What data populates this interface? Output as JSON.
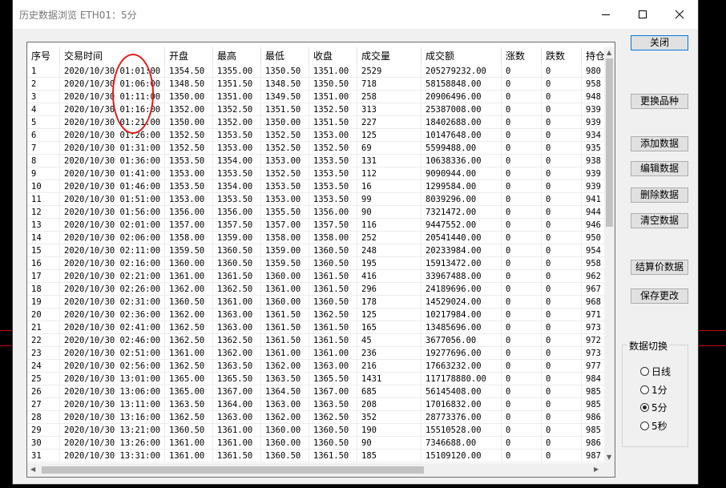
{
  "window": {
    "title": "历史数据浏览 ETH01：5分"
  },
  "table": {
    "columns": [
      "序号",
      "交易时间",
      "开盘",
      "最高",
      "最低",
      "收盘",
      "成交量",
      "成交额",
      "涨数",
      "跌数",
      "持仓"
    ],
    "rows": [
      [
        "1",
        "2020/10/30 01:01:00",
        "1354.50",
        "1355.00",
        "1350.50",
        "1351.00",
        "2529",
        "205279232.00",
        "0",
        "0",
        "980"
      ],
      [
        "2",
        "2020/10/30 01:06:00",
        "1348.50",
        "1351.50",
        "1348.50",
        "1350.50",
        "718",
        "58158848.00",
        "0",
        "0",
        "958"
      ],
      [
        "3",
        "2020/10/30 01:11:00",
        "1350.00",
        "1351.00",
        "1349.50",
        "1351.00",
        "258",
        "20906496.00",
        "0",
        "0",
        "948"
      ],
      [
        "4",
        "2020/10/30 01:16:00",
        "1352.00",
        "1352.50",
        "1351.50",
        "1352.50",
        "313",
        "25387008.00",
        "0",
        "0",
        "939"
      ],
      [
        "5",
        "2020/10/30 01:21:00",
        "1350.00",
        "1352.00",
        "1350.00",
        "1351.50",
        "227",
        "18402688.00",
        "0",
        "0",
        "939"
      ],
      [
        "6",
        "2020/10/30 01:26:00",
        "1352.50",
        "1353.50",
        "1352.50",
        "1353.00",
        "125",
        "10147648.00",
        "0",
        "0",
        "934"
      ],
      [
        "7",
        "2020/10/30 01:31:00",
        "1352.50",
        "1353.00",
        "1352.50",
        "1352.50",
        "69",
        "5599488.00",
        "0",
        "0",
        "935"
      ],
      [
        "8",
        "2020/10/30 01:36:00",
        "1353.50",
        "1354.00",
        "1353.00",
        "1353.50",
        "131",
        "10638336.00",
        "0",
        "0",
        "938"
      ],
      [
        "9",
        "2020/10/30 01:41:00",
        "1353.00",
        "1353.50",
        "1352.50",
        "1353.50",
        "112",
        "9090944.00",
        "0",
        "0",
        "939"
      ],
      [
        "10",
        "2020/10/30 01:46:00",
        "1353.50",
        "1354.00",
        "1353.50",
        "1353.50",
        "16",
        "1299584.00",
        "0",
        "0",
        "939"
      ],
      [
        "11",
        "2020/10/30 01:51:00",
        "1353.00",
        "1353.50",
        "1353.00",
        "1353.50",
        "99",
        "8039296.00",
        "0",
        "0",
        "941"
      ],
      [
        "12",
        "2020/10/30 01:56:00",
        "1356.00",
        "1356.00",
        "1355.50",
        "1356.00",
        "90",
        "7321472.00",
        "0",
        "0",
        "944"
      ],
      [
        "13",
        "2020/10/30 02:01:00",
        "1357.00",
        "1357.50",
        "1357.00",
        "1357.50",
        "116",
        "9447552.00",
        "0",
        "0",
        "946"
      ],
      [
        "14",
        "2020/10/30 02:06:00",
        "1358.00",
        "1359.00",
        "1358.00",
        "1358.00",
        "252",
        "20541440.00",
        "0",
        "0",
        "950"
      ],
      [
        "15",
        "2020/10/30 02:11:00",
        "1359.50",
        "1360.50",
        "1359.00",
        "1360.50",
        "248",
        "20233984.00",
        "0",
        "0",
        "954"
      ],
      [
        "16",
        "2020/10/30 02:16:00",
        "1360.00",
        "1360.50",
        "1359.50",
        "1360.50",
        "195",
        "15913472.00",
        "0",
        "0",
        "958"
      ],
      [
        "17",
        "2020/10/30 02:21:00",
        "1361.00",
        "1361.50",
        "1360.00",
        "1361.50",
        "416",
        "33967488.00",
        "0",
        "0",
        "962"
      ],
      [
        "18",
        "2020/10/30 02:26:00",
        "1362.00",
        "1362.50",
        "1361.00",
        "1361.50",
        "296",
        "24189696.00",
        "0",
        "0",
        "967"
      ],
      [
        "19",
        "2020/10/30 02:31:00",
        "1360.50",
        "1361.00",
        "1360.00",
        "1360.50",
        "178",
        "14529024.00",
        "0",
        "0",
        "968"
      ],
      [
        "20",
        "2020/10/30 02:36:00",
        "1362.00",
        "1363.00",
        "1361.50",
        "1362.50",
        "125",
        "10217984.00",
        "0",
        "0",
        "971"
      ],
      [
        "21",
        "2020/10/30 02:41:00",
        "1362.50",
        "1363.00",
        "1361.50",
        "1361.50",
        "165",
        "13485696.00",
        "0",
        "0",
        "973"
      ],
      [
        "22",
        "2020/10/30 02:46:00",
        "1362.50",
        "1362.50",
        "1361.50",
        "1361.50",
        "45",
        "3677056.00",
        "0",
        "0",
        "972"
      ],
      [
        "23",
        "2020/10/30 02:51:00",
        "1361.00",
        "1362.00",
        "1361.00",
        "1361.00",
        "236",
        "19277696.00",
        "0",
        "0",
        "973"
      ],
      [
        "24",
        "2020/10/30 02:56:00",
        "1362.50",
        "1363.50",
        "1362.00",
        "1363.00",
        "216",
        "17663232.00",
        "0",
        "0",
        "977"
      ],
      [
        "25",
        "2020/10/30 13:01:00",
        "1365.00",
        "1365.50",
        "1363.50",
        "1365.50",
        "1431",
        "117178880.00",
        "0",
        "0",
        "984"
      ],
      [
        "26",
        "2020/10/30 13:06:00",
        "1365.00",
        "1367.00",
        "1364.50",
        "1367.00",
        "685",
        "56145408.00",
        "0",
        "0",
        "985"
      ],
      [
        "27",
        "2020/10/30 13:11:00",
        "1363.50",
        "1364.00",
        "1363.00",
        "1363.50",
        "208",
        "17016832.00",
        "0",
        "0",
        "985"
      ],
      [
        "28",
        "2020/10/30 13:16:00",
        "1362.50",
        "1363.00",
        "1362.00",
        "1362.50",
        "352",
        "28773376.00",
        "0",
        "0",
        "986"
      ],
      [
        "29",
        "2020/10/30 13:21:00",
        "1360.50",
        "1361.00",
        "1360.00",
        "1360.50",
        "190",
        "15510528.00",
        "0",
        "0",
        "985"
      ],
      [
        "30",
        "2020/10/30 13:26:00",
        "1361.00",
        "1361.00",
        "1360.00",
        "1360.50",
        "90",
        "7346688.00",
        "0",
        "0",
        "986"
      ],
      [
        "31",
        "2020/10/30 13:31:00",
        "1361.00",
        "1361.50",
        "1360.50",
        "1361.50",
        "185",
        "15109120.00",
        "0",
        "0",
        "987"
      ]
    ]
  },
  "buttons": {
    "close": "关闭",
    "change_product": "更换品种",
    "add_data": "添加数据",
    "edit_data": "编辑数据",
    "delete_data": "删除数据",
    "clear_data": "清空数据",
    "settlement_data": "结算价数据",
    "save_changes": "保存更改"
  },
  "data_switch": {
    "title": "数据切换",
    "options": [
      "日线",
      "1分",
      "5分",
      "5秒"
    ],
    "selected": "5分"
  },
  "colors": {
    "annotation": "#e31b1b",
    "window_bg": "#f0f0f0",
    "desktop_bg": "#000000"
  }
}
